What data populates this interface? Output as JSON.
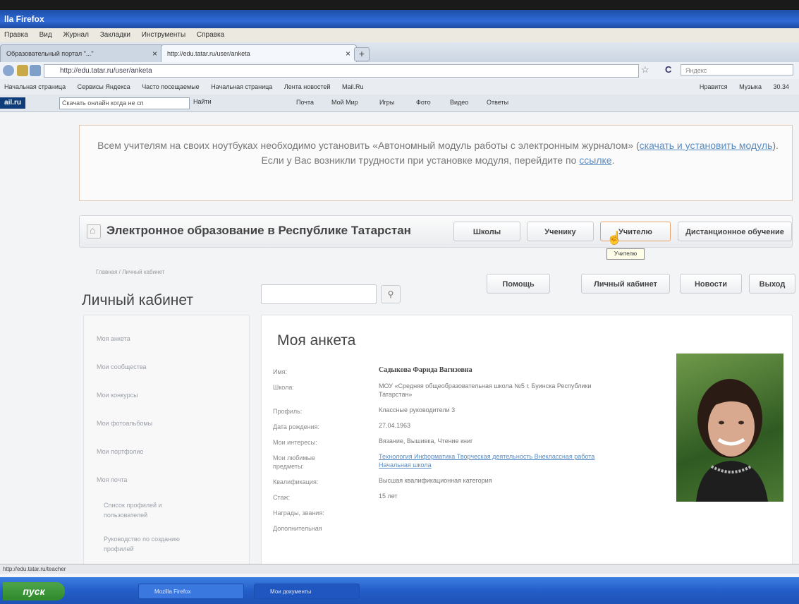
{
  "window": {
    "title": "lla Firefox"
  },
  "menu": [
    "Правка",
    "Вид",
    "Журнал",
    "Закладки",
    "Инструменты",
    "Справка"
  ],
  "tabs": [
    {
      "label": "Образовательный портал \"...\""
    },
    {
      "label": "http://edu.tatar.ru/user/anketa"
    }
  ],
  "nav": {
    "url": "http://edu.tatar.ru/user/anketa",
    "search_placeholder": "Яндекс"
  },
  "bookmarks": {
    "items": [
      "Начальная страница",
      "Сервисы Яндекса",
      "Часто посещаемые",
      "Начальная страница",
      "Лента новостей",
      "Mail.Ru"
    ],
    "right": [
      "Нравится",
      "Музыка",
      "30.34"
    ]
  },
  "toolbar2": {
    "logo": "ail.ru",
    "input_value": "Скачать онлайн когда не сп",
    "find_label": "Найти",
    "items": [
      "Почта",
      "Мой Мир",
      "Игры",
      "Фото",
      "Видео",
      "Ответы"
    ]
  },
  "notice": {
    "text1": "Всем учителям на своих ноутбуках необходимо установить «Автономный модуль работы с электронным журналом» (",
    "link1": "скачать и установить модуль",
    "text2": "). Если у Вас возникли трудности при установке модуля, перейдите по ",
    "link2": "ссылке",
    "text3": "."
  },
  "portal": {
    "title": "Электронное образование в Республике Татарстан",
    "tabs": [
      "Школы",
      "Ученику",
      "Учителю",
      "Дистанционное обучение"
    ],
    "tooltip": "Учителю"
  },
  "breadcrumb": "Главная / Личный кабинет",
  "page_title": "Личный кабинет",
  "top_buttons": [
    "Помощь",
    "Личный кабинет",
    "Новости",
    "Выход"
  ],
  "sidebar": [
    "Моя анкета",
    "Мои сообщества",
    "Мои конкурсы",
    "Мои фотоальбомы",
    "Мои портфолио",
    "Моя почта",
    "Список профилей и пользователей",
    "Руководство по созданию профилей"
  ],
  "profile": {
    "title": "Моя анкета",
    "rows": [
      {
        "label": "Имя:",
        "value": "Садыкова Фарида Вагизовна"
      },
      {
        "label": "Школа:",
        "value": "МОУ «Средняя общеобразовательная школа №5 г. Буинска Республики Татарстан»"
      },
      {
        "label": "Профиль:",
        "value": "Классные руководители 3"
      },
      {
        "label": "Дата рождения:",
        "value": "27.04.1963"
      },
      {
        "label": "Мои интересы:",
        "value": "Вязание, Вышивка, Чтение книг"
      },
      {
        "label": "Мои любимые предметы:",
        "value": "Технология Информатика Творческая деятельность Внеклассная работа Начальная школа"
      },
      {
        "label": "Квалификация:",
        "value": "Высшая квалификационная категория"
      },
      {
        "label": "Стаж:",
        "value": "15 лет"
      },
      {
        "label": "Награды, звания:",
        "value": ""
      },
      {
        "label": "Дополнительная",
        "value": ""
      }
    ]
  },
  "status": "http://edu.tatar.ru/teacher",
  "taskbar": {
    "start": "пуск",
    "tasks": [
      "Mozilla Firefox",
      "Мои документы"
    ]
  }
}
